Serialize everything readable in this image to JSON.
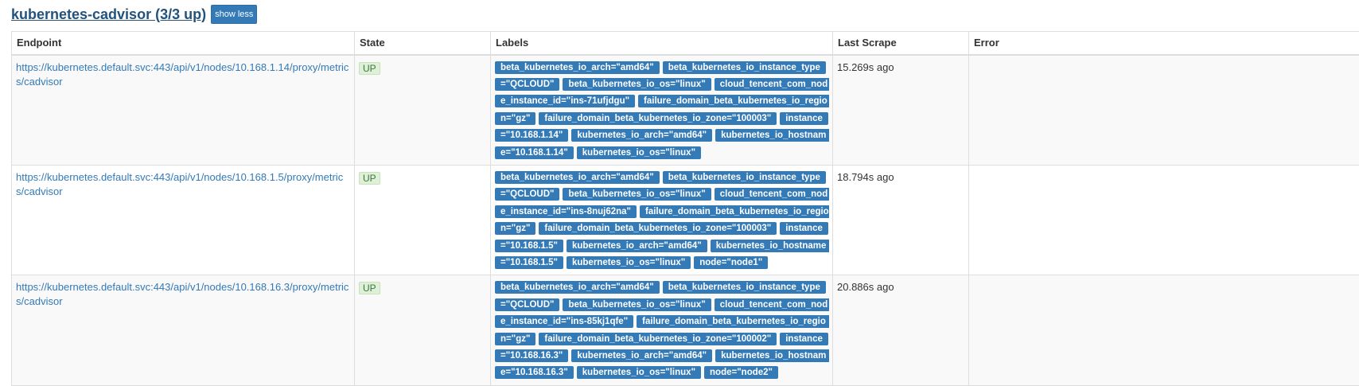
{
  "job": {
    "title": "kubernetes-cadvisor (3/3 up)",
    "toggle_label": "show less"
  },
  "table": {
    "headers": [
      "Endpoint",
      "State",
      "Labels",
      "Last Scrape",
      "Error"
    ],
    "rows": [
      {
        "endpoint": "https://kubernetes.default.svc:443/api/v1/nodes/10.168.1.14/proxy/metrics/cadvisor",
        "state": "UP",
        "labels": [
          "beta_kubernetes_io_arch=\"amd64\"",
          "beta_kubernetes_io_instance_type=\"QCLOUD\"",
          "beta_kubernetes_io_os=\"linux\"",
          "cloud_tencent_com_node_instance_id=\"ins-71ufjdgu\"",
          "failure_domain_beta_kubernetes_io_region=\"gz\"",
          "failure_domain_beta_kubernetes_io_zone=\"100003\"",
          "instance=\"10.168.1.14\"",
          "kubernetes_io_arch=\"amd64\"",
          "kubernetes_io_hostname=\"10.168.1.14\"",
          "kubernetes_io_os=\"linux\""
        ],
        "last_scrape": "15.269s ago",
        "error": ""
      },
      {
        "endpoint": "https://kubernetes.default.svc:443/api/v1/nodes/10.168.1.5/proxy/metrics/cadvisor",
        "state": "UP",
        "labels": [
          "beta_kubernetes_io_arch=\"amd64\"",
          "beta_kubernetes_io_instance_type=\"QCLOUD\"",
          "beta_kubernetes_io_os=\"linux\"",
          "cloud_tencent_com_node_instance_id=\"ins-8nuj62na\"",
          "failure_domain_beta_kubernetes_io_region=\"gz\"",
          "failure_domain_beta_kubernetes_io_zone=\"100003\"",
          "instance=\"10.168.1.5\"",
          "kubernetes_io_arch=\"amd64\"",
          "kubernetes_io_hostname=\"10.168.1.5\"",
          "kubernetes_io_os=\"linux\"",
          "node=\"node1\""
        ],
        "last_scrape": "18.794s ago",
        "error": ""
      },
      {
        "endpoint": "https://kubernetes.default.svc:443/api/v1/nodes/10.168.16.3/proxy/metrics/cadvisor",
        "state": "UP",
        "labels": [
          "beta_kubernetes_io_arch=\"amd64\"",
          "beta_kubernetes_io_instance_type=\"QCLOUD\"",
          "beta_kubernetes_io_os=\"linux\"",
          "cloud_tencent_com_node_instance_id=\"ins-85kj1qfe\"",
          "failure_domain_beta_kubernetes_io_region=\"gz\"",
          "failure_domain_beta_kubernetes_io_zone=\"100002\"",
          "instance=\"10.168.16.3\"",
          "kubernetes_io_arch=\"amd64\"",
          "kubernetes_io_hostname=\"10.168.16.3\"",
          "kubernetes_io_os=\"linux\"",
          "node=\"node2\""
        ],
        "last_scrape": "20.886s ago",
        "error": ""
      }
    ]
  },
  "colors": {
    "link": "#337ab7",
    "label_bg": "#337ab7",
    "up_bg": "#dff0d8",
    "up_text": "#3c763d"
  }
}
